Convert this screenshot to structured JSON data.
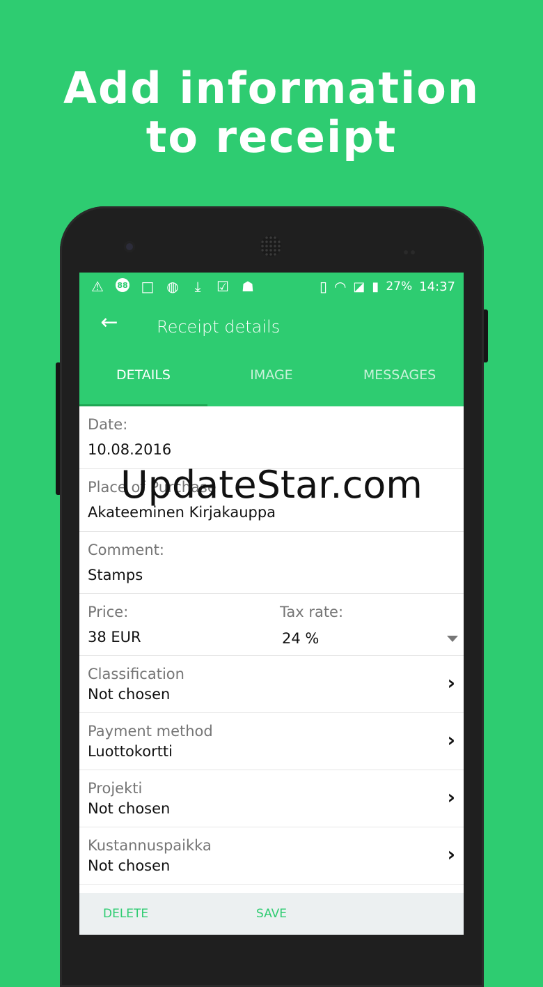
{
  "headline": {
    "line1": "Add information",
    "line2": "to receipt"
  },
  "statusbar": {
    "icons": [
      "warning-icon",
      "badge-88-icon",
      "square-icon",
      "dribbble-icon",
      "download-icon",
      "clipboard-check-icon",
      "robot-icon"
    ],
    "badge": "88",
    "battery": "27%",
    "time": "14:37"
  },
  "toolbar": {
    "title": "Receipt details"
  },
  "tabs": [
    {
      "label": "DETAILS",
      "active": true
    },
    {
      "label": "IMAGE",
      "active": false
    },
    {
      "label": "MESSAGES",
      "active": false
    }
  ],
  "fields": {
    "date": {
      "label": "Date:",
      "value": "10.08.2016"
    },
    "place": {
      "label": "Place of Purchase",
      "value": "Akateeminen Kirjakauppa"
    },
    "comment": {
      "label": "Comment:",
      "value": "Stamps"
    },
    "price": {
      "label": "Price:",
      "value": "38 EUR"
    },
    "tax": {
      "label": "Tax rate:",
      "value": "24 %"
    },
    "classification": {
      "label": "Classification",
      "value": "Not chosen"
    },
    "payment": {
      "label": "Payment method",
      "value": "Luottokortti"
    },
    "project": {
      "label": "Projekti",
      "value": "Not chosen"
    },
    "cost_center": {
      "label": "Kustannuspaikka",
      "value": "Not chosen"
    }
  },
  "actions": {
    "delete": "DELETE",
    "save": "SAVE"
  },
  "watermark": "UpdateStar.com",
  "colors": {
    "accent": "#2ecc71",
    "accent_dark": "#1fa653",
    "bottombar": "#ecf0f1"
  }
}
